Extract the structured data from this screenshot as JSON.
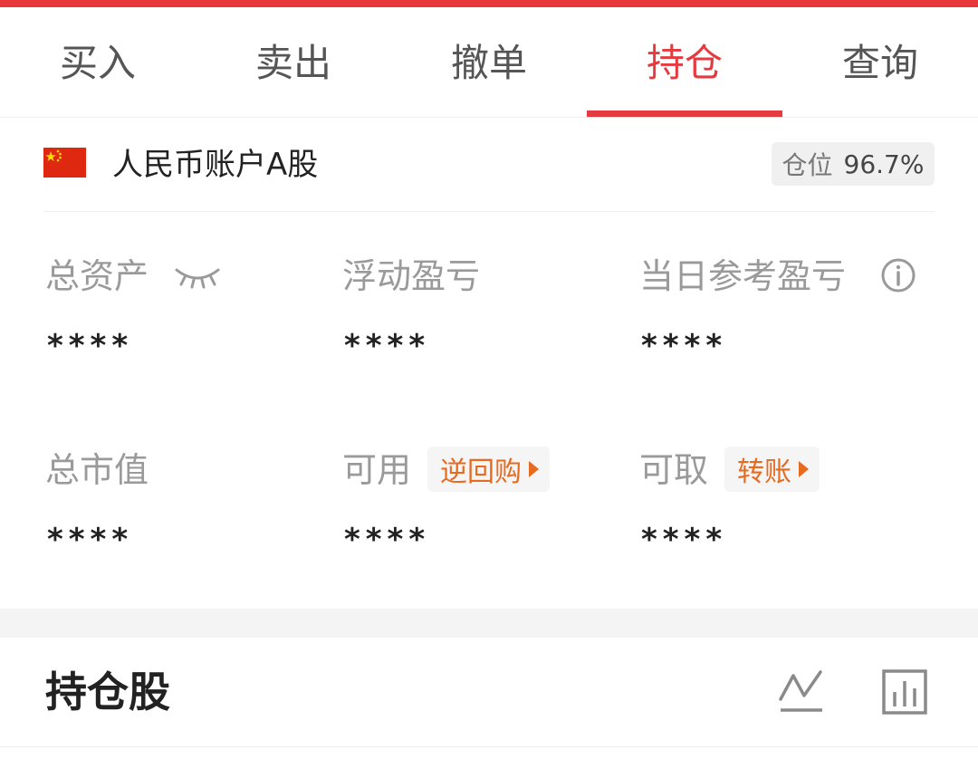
{
  "colors": {
    "accent_red": "#e53a3f",
    "orange_link": "#e86a1f",
    "muted_text": "#9a9a9a"
  },
  "tabs": [
    {
      "label": "买入"
    },
    {
      "label": "卖出"
    },
    {
      "label": "撤单"
    },
    {
      "label": "持仓",
      "active": true
    },
    {
      "label": "查询"
    }
  ],
  "account": {
    "flag_icon": "china-flag-icon",
    "name": "人民币账户A股",
    "position_label": "仓位",
    "position_value": "96.7%"
  },
  "stats": {
    "total_assets": {
      "label": "总资产",
      "value": "****",
      "icon": "eye-closed-icon"
    },
    "floating_pl": {
      "label": "浮动盈亏",
      "value": "****"
    },
    "daily_pl": {
      "label": "当日参考盈亏",
      "value": "****",
      "icon": "info-icon"
    },
    "market_value": {
      "label": "总市值",
      "value": "****"
    },
    "available": {
      "label": "可用",
      "value": "****",
      "action": "逆回购"
    },
    "withdrawable": {
      "label": "可取",
      "value": "****",
      "action": "转账"
    }
  },
  "holdings": {
    "title": "持仓股",
    "icons": [
      "line-chart-icon",
      "bar-chart-icon"
    ]
  }
}
